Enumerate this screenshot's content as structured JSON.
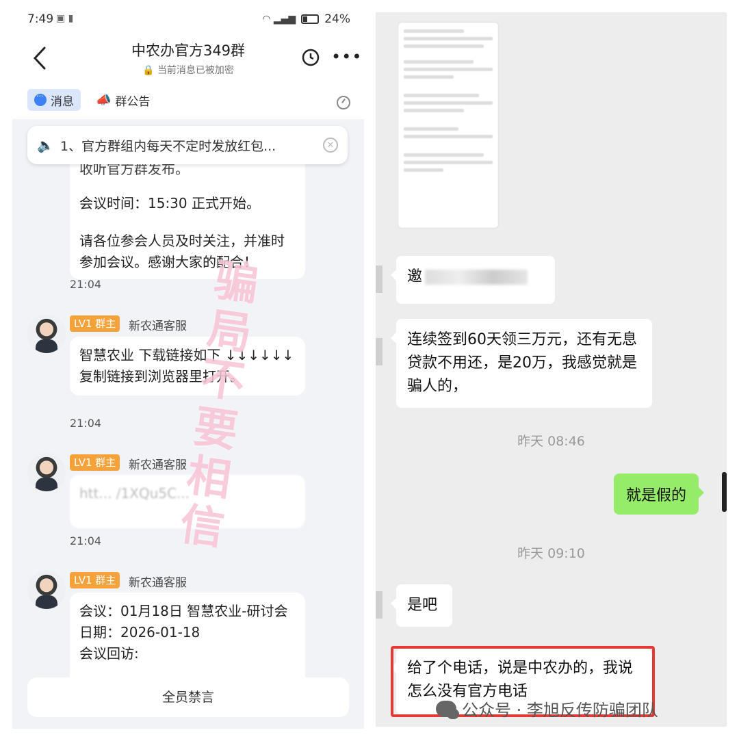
{
  "left": {
    "status_bar": {
      "time": "7:49",
      "battery": "24%"
    },
    "header": {
      "title": "中农办官方349群",
      "subtitle": "当前消息已被加密"
    },
    "tabs": {
      "messages": "消息",
      "notice": "群公告"
    },
    "announcement": "1、官方群组内每天不定时发放红包...",
    "messages": [
      {
        "lines": [
          "收听官方群发布。",
          "会议时间：15:30 正式开始。",
          "请各位参会人员及时关注，并准时参加会议。感谢大家的配合！"
        ],
        "time": "21:04"
      },
      {
        "badge": "LV1 群主",
        "sender": "新农通客服",
        "text": "智慧农业 下载链接如下 ↓↓↓↓↓↓ 复制链接到浏览器里打开。",
        "time": "21:04"
      },
      {
        "badge": "LV1 群主",
        "sender": "新农通客服",
        "text": "htt... /1XQu5C...",
        "time": "21:04"
      },
      {
        "badge": "LV1 群主",
        "sender": "新农通客服",
        "lines": [
          "会议：01月18日 智慧农业-研讨会",
          "日期：2026-01-18",
          "会议回访:"
        ]
      }
    ],
    "watermark": "骗局不要相信",
    "mute_bar": "全员禁言"
  },
  "right": {
    "bubble1": "邀",
    "bubble2": "连续签到60天领三万元，还有无息贷款不用还，是20万，我感觉就是骗人的，",
    "ts1": "昨天 08:46",
    "my_reply": "就是假的",
    "ts2": "昨天 09:10",
    "bubble3": "是吧",
    "bubble4": "给了个电话，说是中农办的，我说怎么没有官方电话",
    "footer": "公众号 · 李旭反传防骗团队"
  },
  "colors": {
    "badge": "#f5a23a",
    "highlight_box": "#e53935",
    "my_bubble": "#95ec69",
    "accent": "#3b82f6"
  }
}
